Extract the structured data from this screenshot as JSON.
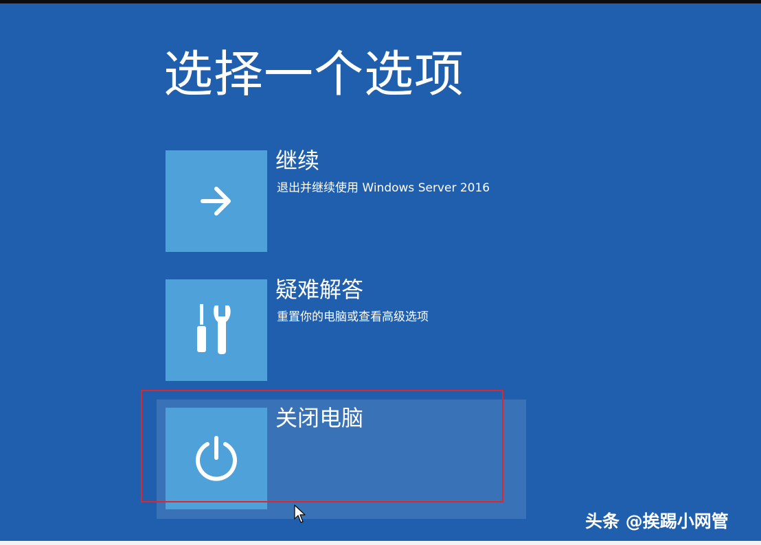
{
  "screen": {
    "title": "选择一个选项",
    "background_color": "#1f5fae",
    "tile_color": "#4ea2d9",
    "highlight_color": "#e0262d"
  },
  "options": [
    {
      "id": "continue",
      "icon": "arrow-right-icon",
      "title": "继续",
      "description": "退出并继续使用 Windows Server 2016"
    },
    {
      "id": "troubleshoot",
      "icon": "tools-icon",
      "title": "疑难解答",
      "description": "重置你的电脑或查看高级选项"
    },
    {
      "id": "shutdown",
      "icon": "power-icon",
      "title": "关闭电脑",
      "description": "",
      "state": "hovered"
    }
  ],
  "watermark": {
    "text": "头条 @挨踢小网管"
  }
}
